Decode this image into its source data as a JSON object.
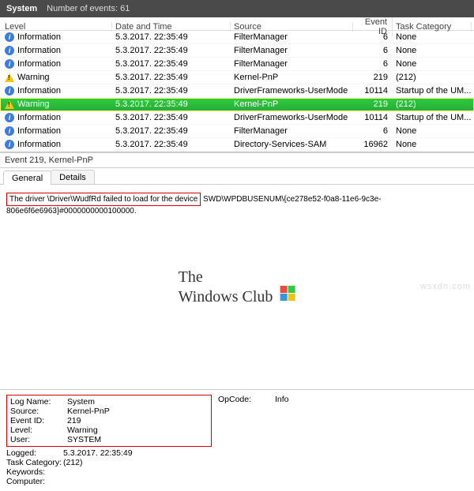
{
  "titlebar": {
    "app": "System",
    "meta": "Number of events: 61"
  },
  "columns": {
    "level": "Level",
    "date": "Date and Time",
    "source": "Source",
    "eventid": "Event ID",
    "task": "Task Category"
  },
  "rows": [
    {
      "icon": "info",
      "level": "Information",
      "date": "5.3.2017. 22:35:49",
      "source": "FilterManager",
      "eventid": "6",
      "task": "None"
    },
    {
      "icon": "info",
      "level": "Information",
      "date": "5.3.2017. 22:35:49",
      "source": "FilterManager",
      "eventid": "6",
      "task": "None"
    },
    {
      "icon": "info",
      "level": "Information",
      "date": "5.3.2017. 22:35:49",
      "source": "FilterManager",
      "eventid": "6",
      "task": "None"
    },
    {
      "icon": "warn",
      "level": "Warning",
      "date": "5.3.2017. 22:35:49",
      "source": "Kernel-PnP",
      "eventid": "219",
      "task": "(212)"
    },
    {
      "icon": "info",
      "level": "Information",
      "date": "5.3.2017. 22:35:49",
      "source": "DriverFrameworks-UserMode",
      "eventid": "10114",
      "task": "Startup of the UM..."
    },
    {
      "icon": "warn",
      "level": "Warning",
      "date": "5.3.2017. 22:35:49",
      "source": "Kernel-PnP",
      "eventid": "219",
      "task": "(212)",
      "selected": true
    },
    {
      "icon": "info",
      "level": "Information",
      "date": "5.3.2017. 22:35:49",
      "source": "DriverFrameworks-UserMode",
      "eventid": "10114",
      "task": "Startup of the UM..."
    },
    {
      "icon": "info",
      "level": "Information",
      "date": "5.3.2017. 22:35:49",
      "source": "FilterManager",
      "eventid": "6",
      "task": "None"
    },
    {
      "icon": "info",
      "level": "Information",
      "date": "5.3.2017. 22:35:49",
      "source": "Directory-Services-SAM",
      "eventid": "16962",
      "task": "None"
    }
  ],
  "detail": {
    "title": "Event 219, Kernel-PnP",
    "tabs": {
      "general": "General",
      "details": "Details"
    },
    "message_boxed": "The driver \\Driver\\WudfRd failed to load for the device",
    "message_tail": " SWD\\WPDBUSENUM\\{ce278e52-f0a8-11e6-9c3e-806e6f6e6963}#0000000000100000.",
    "brand": {
      "l1": "The",
      "l2": "Windows Club"
    },
    "watermark": "wsxdn.com"
  },
  "props": {
    "left": [
      {
        "k": "Log Name:",
        "v": "System"
      },
      {
        "k": "Source:",
        "v": "Kernel-PnP"
      },
      {
        "k": "Event ID:",
        "v": "219"
      },
      {
        "k": "Level:",
        "v": "Warning"
      },
      {
        "k": "User:",
        "v": "SYSTEM"
      },
      {
        "k": "OpCode:",
        "v": "Info"
      }
    ],
    "right": [
      {
        "k": "Logged:",
        "v": "5.3.2017. 22:35:49"
      },
      {
        "k": "Task Category:",
        "v": "(212)"
      },
      {
        "k": "Keywords:",
        "v": ""
      },
      {
        "k": "Computer:",
        "v": ""
      }
    ]
  }
}
